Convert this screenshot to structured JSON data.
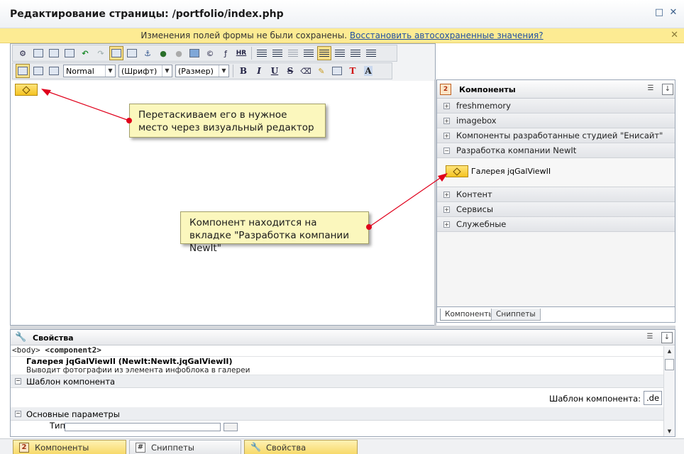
{
  "window": {
    "title": "Редактирование страницы: /portfolio/index.php"
  },
  "warning": {
    "message": "Изменения полей формы не были сохранены.",
    "restore_link": "Восстановить автосохраненные значения?"
  },
  "toolbar": {
    "style_combo": "Normal",
    "font_combo": "(Шрифт)",
    "size_combo": "(Размер)",
    "hr_label": "HR",
    "bold_label": "B",
    "italic_label": "I",
    "underline_label": "U",
    "strike_label": "S",
    "text_color_label": "T",
    "bg_color_label": "A"
  },
  "notes": {
    "drag_note": "Перетаскиваем его в нужное место через визуальный редактор",
    "tab_note": "Компонент находится на вкладке \"Разработка компании NewIt\""
  },
  "components_panel": {
    "header": "Компоненты",
    "groups": [
      {
        "label": "freshmemory"
      },
      {
        "label": "imagebox"
      },
      {
        "label": "Компоненты разработанные студией \"Енисайт\""
      },
      {
        "label": "Разработка компании NewIt"
      }
    ],
    "expanded_item": "Галерея jqGalViewII",
    "groups_after": [
      {
        "label": "Контент"
      },
      {
        "label": "Сервисы"
      },
      {
        "label": "Служебные"
      }
    ],
    "tabs": [
      "Компоненты",
      "Сниппеты"
    ]
  },
  "properties": {
    "header": "Свойства",
    "crumb_body": "<body>",
    "crumb_component": "<component2>",
    "component_name": "Галерея jqGalViewII (NewIt:NewIt.jqGalViewII)",
    "component_desc": "Выводит фотографии из элемента инфоблока в галереи",
    "section_template": "Шаблон компонента",
    "template_label": "Шаблон компонента:",
    "template_value": ".de",
    "section_main": "Основные параметры",
    "type_label": "Тип"
  },
  "bottom_tabs": [
    "Компоненты",
    "Сниппеты",
    "Свойства"
  ],
  "colors": {
    "warning_bg": "#fdeb93",
    "note_bg": "#fbf7bd",
    "arrow": "#e0001b",
    "component_chip": "#f4c322"
  }
}
